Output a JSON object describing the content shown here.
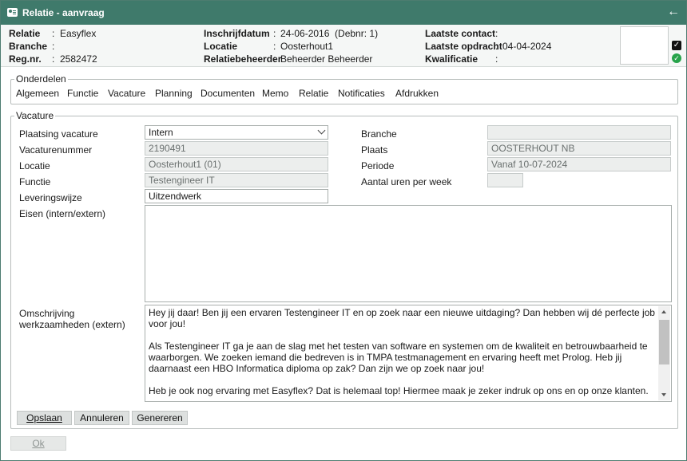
{
  "window": {
    "title": "Relatie - aanvraag",
    "back_icon": "arrow-left-icon"
  },
  "header": {
    "col1": [
      {
        "label": "Relatie",
        "value": "Easyflex"
      },
      {
        "label": "Branche",
        "value": ""
      },
      {
        "label": "Reg.nr.",
        "value": "2582472"
      }
    ],
    "col2": [
      {
        "label": "Inschrijfdatum",
        "value": "24-06-2016  (Debnr: 1)"
      },
      {
        "label": "Locatie",
        "value": "Oosterhout1"
      },
      {
        "label": "Relatiebeheerder",
        "value": "Beheerder Beheerder"
      }
    ],
    "col3": [
      {
        "label": "Laatste contact",
        "value": ""
      },
      {
        "label": "Laatste opdracht",
        "value": "04-04-2024"
      },
      {
        "label": "Kwalificatie",
        "value": ""
      }
    ]
  },
  "onderdelen": {
    "legend": "Onderdelen",
    "tabs": [
      "Algemeen",
      "Functie",
      "Vacature",
      "Planning",
      "Documenten",
      "Memo",
      "Relatie",
      "Notificaties",
      "Afdrukken"
    ]
  },
  "vacature": {
    "legend": "Vacature",
    "plaatsing_label": "Plaatsing vacature",
    "plaatsing_value": "Intern",
    "vacaturenummer_label": "Vacaturenummer",
    "vacaturenummer_value": "2190491",
    "locatie_label": "Locatie",
    "locatie_value": "Oosterhout1 (01)",
    "functie_label": "Functie",
    "functie_value": "Testengineer IT",
    "leveringswijze_label": "Leveringswijze",
    "leveringswijze_value": "Uitzendwerk",
    "branche_label": "Branche",
    "branche_value": "",
    "plaats_label": "Plaats",
    "plaats_value": "OOSTERHOUT NB",
    "periode_label": "Periode",
    "periode_value": "Vanaf 10-07-2024",
    "uren_label": "Aantal uren per week",
    "uren_value": "",
    "eisen_label": "Eisen (intern/extern)",
    "eisen_value": "",
    "omschrijving_label": "Omschrijving werkzaamheden (extern)",
    "omschrijving_value": "Hey jij daar! Ben jij een ervaren Testengineer IT en op zoek naar een nieuwe uitdaging? Dan hebben wij dé perfecte job voor jou!\n\nAls Testengineer IT ga je aan de slag met het testen van software en systemen om de kwaliteit en betrouwbaarheid te waarborgen. We zoeken iemand die bedreven is in TMPA testmanagement en ervaring heeft met Prolog. Heb jij daarnaast een HBO Informatica diploma op zak? Dan zijn we op zoek naar jou!\n\nHeb je ook nog ervaring met Easyflex? Dat is helemaal top! Hiermee maak je zeker indruk op ons en op onze klanten.\n\nAls Testengineer IT speel je een essentiële rol in het testproces en zorg je ervoor dat eventuele bugs en fouten tijdig worden"
  },
  "buttons": {
    "opslaan": "Opslaan",
    "annuleren": "Annuleren",
    "genereren": "Genereren",
    "ok": "Ok"
  },
  "colors": {
    "titlebar": "#3f7a6b",
    "status_ok": "#27a34a"
  }
}
